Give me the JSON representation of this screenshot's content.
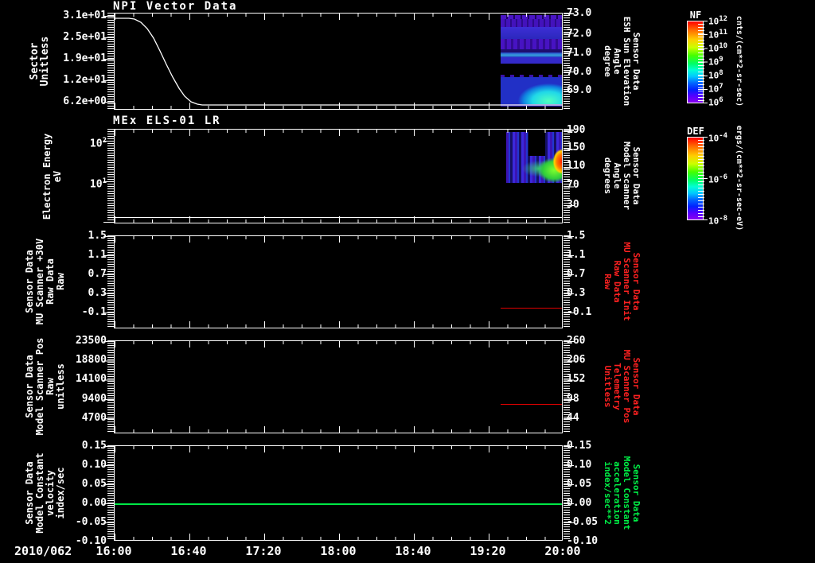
{
  "x_axis": {
    "date": "2010/062",
    "ticks": [
      "16:00",
      "16:40",
      "17:20",
      "18:00",
      "18:40",
      "19:20",
      "20:00"
    ]
  },
  "panels": [
    {
      "title": "NPI Vector Data",
      "left_axis": {
        "label_lines": [
          "Sector",
          "Unitless"
        ],
        "ticks": [
          "3.1e+01",
          "2.5e+01",
          "1.9e+01",
          "1.2e+01",
          "6.2e+00"
        ]
      },
      "right_axis": {
        "label_lines": [
          "Sensor Data",
          "ESH Sun Elevation",
          "Angle",
          "degree"
        ],
        "ticks": [
          "73.0",
          "72.0",
          "71.0",
          "70.0",
          "69.0"
        ]
      }
    },
    {
      "title": "MEx ELS-01 LR",
      "left_axis": {
        "label_lines": [
          "Electron Energy",
          "eV"
        ],
        "ticks": [
          {
            "b": "10",
            "e": "2"
          },
          {
            "b": "10",
            "e": "1"
          }
        ]
      },
      "right_axis": {
        "label_lines": [
          "Sensor Data",
          "Model Scanner",
          "Angle",
          "degrees"
        ],
        "ticks": [
          "190",
          "150",
          "110",
          "70",
          "30"
        ]
      }
    },
    {
      "title": "",
      "left_axis": {
        "label_lines": [
          "Sensor Data",
          "MU Scanner +30V",
          "Raw Data",
          "Raw"
        ],
        "ticks": [
          "1.5",
          "1.1",
          "0.7",
          "0.3",
          "-0.1"
        ]
      },
      "right_axis": {
        "label_lines": [
          "Sensor Data",
          "MU Scanner Init",
          "Raw Data",
          "Raw"
        ],
        "ticks": [
          "1.5",
          "1.1",
          "0.7",
          "0.3",
          "-0.1"
        ],
        "color": "#ff2121"
      }
    },
    {
      "title": "",
      "left_axis": {
        "label_lines": [
          "Sensor Data",
          "Model Scanner Pos",
          "Raw",
          "unitless"
        ],
        "ticks": [
          "23500",
          "18800",
          "14100",
          "9400",
          "4700"
        ]
      },
      "right_axis": {
        "label_lines": [
          "Sensor Data",
          "MU Scanner Pos",
          "Telemetry",
          "Unitless"
        ],
        "ticks": [
          "260",
          "206",
          "152",
          "98",
          "44"
        ],
        "color": "#ff2121"
      }
    },
    {
      "title": "",
      "left_axis": {
        "label_lines": [
          "Sensor Data",
          "Model Constant",
          "velocity",
          "index/sec"
        ],
        "ticks": [
          "0.15",
          "0.10",
          "0.05",
          "0.00",
          "-0.05",
          "-0.10"
        ]
      },
      "right_axis": {
        "label_lines": [
          "Sensor Data",
          "Model Constant",
          "acceleration",
          "index/sec**2"
        ],
        "ticks": [
          "0.15",
          "0.10",
          "0.05",
          "0.00",
          "-0.05",
          "-0.10"
        ],
        "color": "#00f046"
      }
    }
  ],
  "colorbars": [
    {
      "title": "NF",
      "ticks": [
        {
          "b": "10",
          "e": "12"
        },
        {
          "b": "10",
          "e": "11"
        },
        {
          "b": "10",
          "e": "10"
        },
        {
          "b": "10",
          "e": "9"
        },
        {
          "b": "10",
          "e": "8"
        },
        {
          "b": "10",
          "e": "7"
        },
        {
          "b": "10",
          "e": "6"
        }
      ],
      "unit": "cnts/(cm**2-sr-sec)"
    },
    {
      "title": "DEF",
      "ticks": [
        {
          "b": "10",
          "e": "-4"
        },
        {
          "b": "10",
          "e": "-6"
        },
        {
          "b": "10",
          "e": "-8"
        }
      ],
      "unit": "ergs/(cm**2-sr-sec-eV)"
    }
  ],
  "chart_data": [
    {
      "panel": 1,
      "type": "line",
      "title": "NPI Vector Data",
      "ylabel": "Sector Unitless",
      "yticks_left": [
        31.0,
        24.8,
        18.6,
        12.4,
        6.2
      ],
      "ylabel_right": "Sensor Data ESH Sun Elevation Angle (degree)",
      "yticks_right": [
        73.0,
        72.0,
        71.0,
        70.0,
        69.0
      ],
      "x_range": [
        "16:00",
        "20:00"
      ],
      "series": [
        {
          "name": "Sector",
          "color": "#ffffff",
          "x": [
            "16:00",
            "16:07",
            "16:12",
            "16:18",
            "16:24",
            "16:30",
            "16:36",
            "16:42",
            "17:00",
            "18:00",
            "19:00",
            "20:00"
          ],
          "y": [
            30,
            30,
            27,
            22,
            15,
            8,
            5.2,
            4.6,
            4.6,
            4.6,
            4.6,
            4.6
          ]
        }
      ],
      "overlay_spectrogram": {
        "time_range": [
          "19:26",
          "20:00"
        ],
        "colorbar": "NF",
        "description": "mostly blue/purple (~1e6-1e7 cnts), horizontal banding, cyan-green enhancement (~1e8) at bottom right 19:40-20:00, black gaps"
      }
    },
    {
      "panel": 2,
      "type": "heatmap",
      "title": "MEx ELS-01 LR",
      "ylabel": "Electron Energy (eV)",
      "yscale": "log",
      "yticks_left": [
        100,
        10
      ],
      "ylim": [
        1,
        400
      ],
      "ylabel_right": "Sensor Data Model Scanner Angle (degrees)",
      "yticks_right": [
        190,
        150,
        110,
        70,
        30
      ],
      "spectrogram": {
        "time_range": [
          "19:29",
          "19:58"
        ],
        "energy_range_eV": [
          9,
          170
        ],
        "colorbar": "DEF",
        "description": "vertical blue/purple streaks; yellow-orange-red blob (~1e-5 ergs) near 19:50-19:58 around 20-120 eV; black notch at top middle"
      },
      "line": {
        "name": "lowest energy trace",
        "color": "#ffffff",
        "value_eV": 1.2,
        "x_range": [
          "16:00",
          "20:00"
        ]
      }
    },
    {
      "panel": 3,
      "type": "line",
      "ylabel": "Sensor Data MU Scanner +30V Raw Data (Raw)",
      "yticks": [
        1.5,
        1.1,
        0.7,
        0.3,
        -0.1
      ],
      "series": [
        {
          "name": "MU Scanner Init Raw Data (Raw)",
          "color": "#ff0000",
          "x_range": [
            "19:26",
            "20:00"
          ],
          "y_constant": 0.0
        }
      ]
    },
    {
      "panel": 4,
      "type": "line",
      "ylabel": "Sensor Data Model Scanner Pos Raw (unitless)",
      "yticks_left": [
        23500,
        18800,
        14100,
        9400,
        4700
      ],
      "ylabel_right": "Sensor Data MU Scanner Pos Telemetry (Unitless)",
      "yticks_right": [
        260,
        206,
        152,
        98,
        44
      ],
      "series": [
        {
          "name": "MU Scanner Pos Telemetry",
          "color": "#ff0000",
          "x_range": [
            "19:26",
            "20:00"
          ],
          "y_constant_left": 8200,
          "y_constant_right": 85
        }
      ]
    },
    {
      "panel": 5,
      "type": "line",
      "ylabel": "Sensor Data Model Constant velocity (index/sec)",
      "yticks": [
        0.15,
        0.1,
        0.05,
        0.0,
        -0.05,
        -0.1
      ],
      "ylabel_right": "Sensor Data Model Constant acceleration (index/sec**2)",
      "series": [
        {
          "name": "Model Constant velocity",
          "color": "#00e846",
          "x_range": [
            "16:00",
            "20:00"
          ],
          "y_constant": 0.0
        }
      ]
    }
  ]
}
